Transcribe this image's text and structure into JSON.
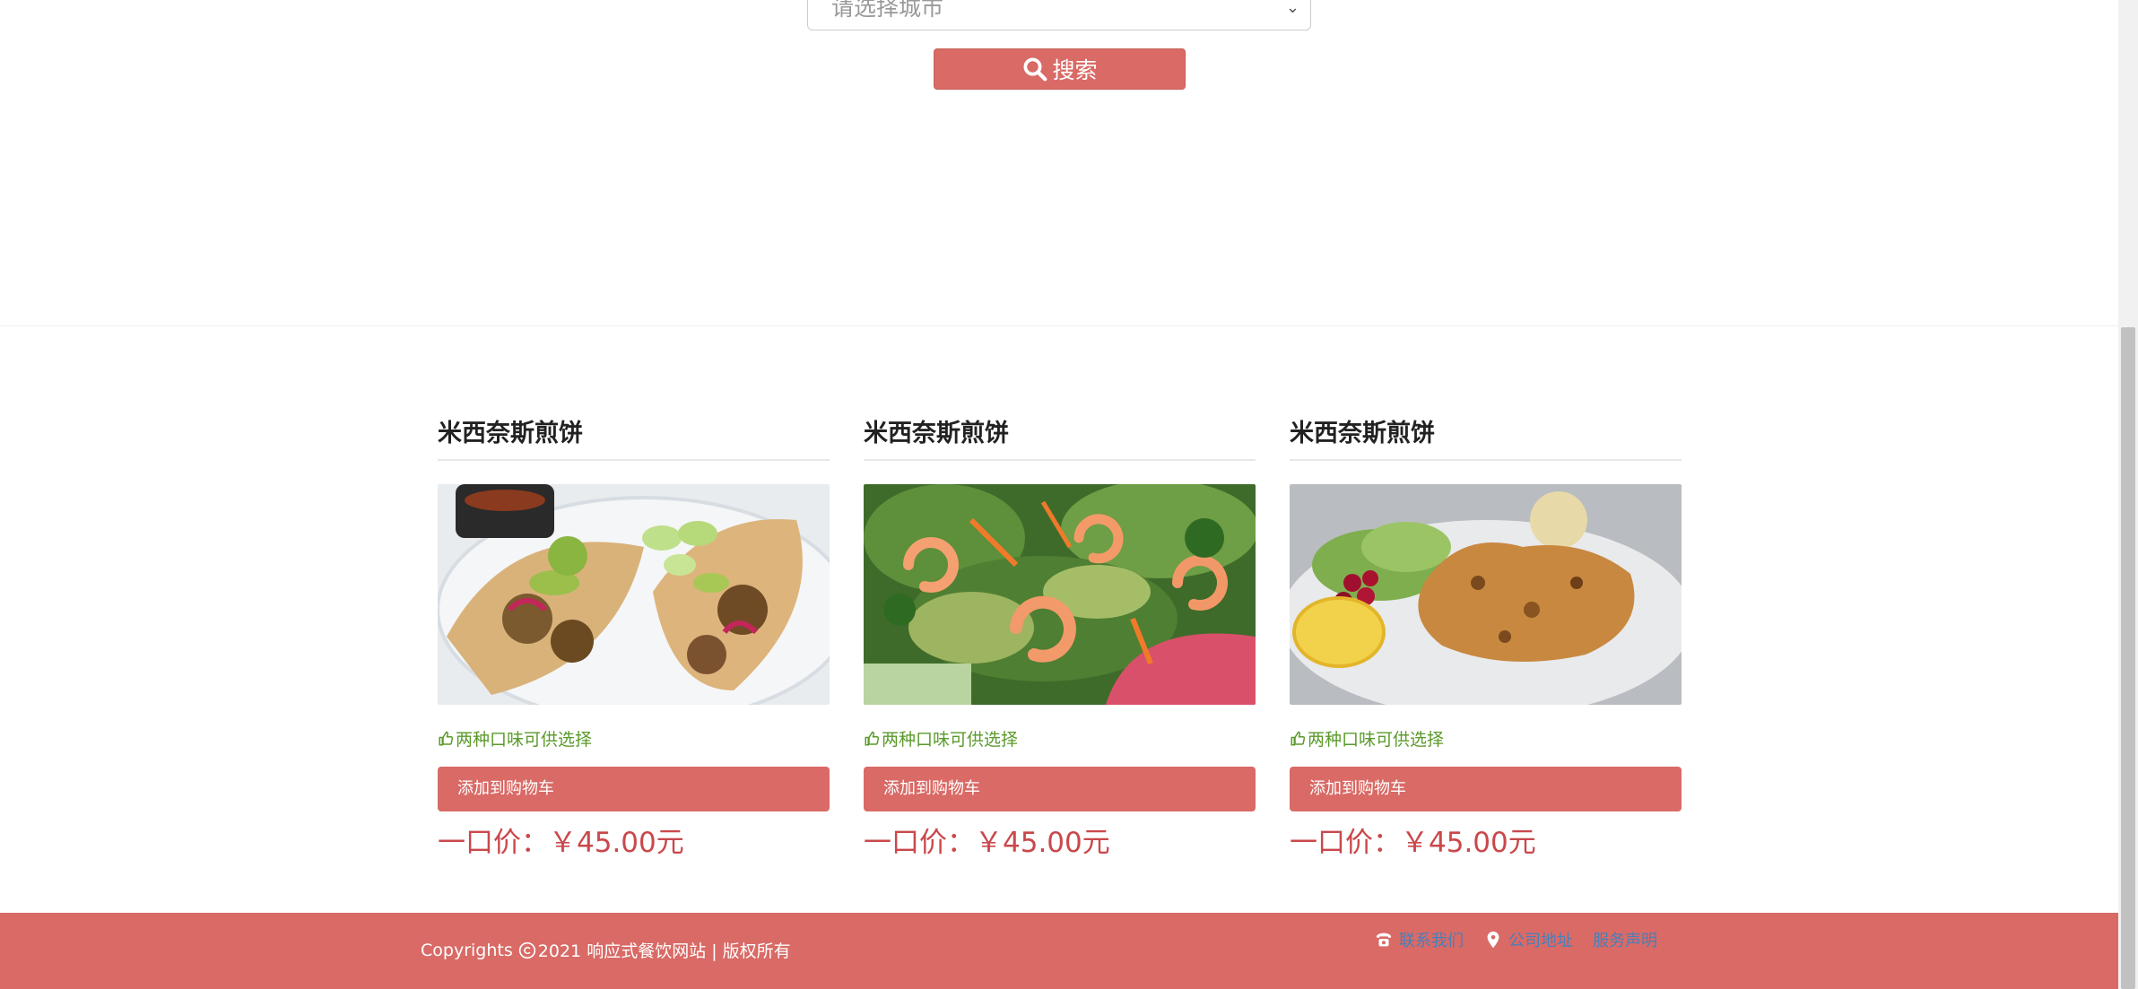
{
  "search": {
    "city_placeholder": "请选择城市",
    "button_label": "搜索"
  },
  "products": [
    {
      "title": "米西奈斯煎饼",
      "tip": "两种口味可供选择",
      "cart_label": "添加到购物车",
      "price": "一口价：￥45.00元",
      "image": "tacos"
    },
    {
      "title": "米西奈斯煎饼",
      "tip": "两种口味可供选择",
      "cart_label": "添加到购物车",
      "price": "一口价：￥45.00元",
      "image": "shrimp-salad"
    },
    {
      "title": "米西奈斯煎饼",
      "tip": "两种口味可供选择",
      "cart_label": "添加到购物车",
      "price": "一口价：￥45.00元",
      "image": "grilled-chicken"
    }
  ],
  "footer": {
    "copyright_prefix": "Copyrights ",
    "copyright_text": "2021 响应式餐饮网站 | 版权所有",
    "links": [
      {
        "label": "联系我们",
        "icon": "phone-icon"
      },
      {
        "label": "公司地址",
        "icon": "map-marker-icon"
      },
      {
        "label": "服务声明",
        "icon": ""
      }
    ]
  },
  "colors": {
    "accent": "#d96a66",
    "price": "#c9484b",
    "tip": "#5a9a2a",
    "link": "#4a7fb8"
  }
}
